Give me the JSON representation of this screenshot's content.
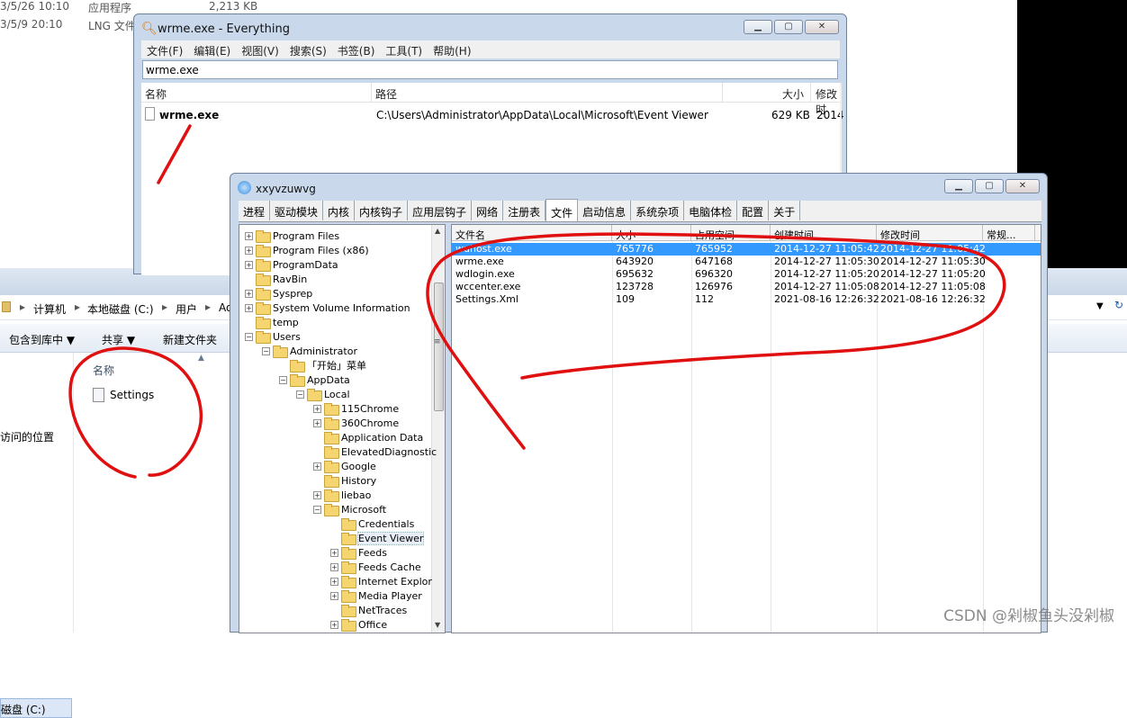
{
  "background_list": {
    "rows": [
      {
        "date": "3/5/26 10:10",
        "type": "应用程序",
        "size": "2,213 KB"
      },
      {
        "date": "3/5/9 20:10",
        "type": "LNG 文件",
        "size": ""
      }
    ]
  },
  "explorer": {
    "breadcrumb": [
      "计算机",
      "本地磁盘 (C:)",
      "用户",
      "Ad"
    ],
    "toolbar": {
      "include_library": "包含到库中 ▼",
      "share": "共享 ▼",
      "new_folder": "新建文件夹"
    },
    "column_name": "名称",
    "file_name": "Settings",
    "nav_recent": "访问的位置",
    "nav_drive": "磁盘 (C:)"
  },
  "everything": {
    "title": "wrme.exe - Everything",
    "menu": [
      "文件(F)",
      "编辑(E)",
      "视图(V)",
      "搜索(S)",
      "书签(B)",
      "工具(T)",
      "帮助(H)"
    ],
    "search_value": "wrme.exe",
    "columns": {
      "name": "名称",
      "path": "路径",
      "size": "大小",
      "modified": "修改时"
    },
    "result": {
      "name": "wrme.exe",
      "path": "C:\\Users\\Administrator\\AppData\\Local\\Microsoft\\Event Viewer",
      "size": "629 KB",
      "modified": "2014"
    }
  },
  "xw": {
    "title": "xxyvzuwvg",
    "tabs": [
      "进程",
      "驱动模块",
      "内核",
      "内核钩子",
      "应用层钩子",
      "网络",
      "注册表",
      "文件",
      "启动信息",
      "系统杂项",
      "电脑体检",
      "配置",
      "关于"
    ],
    "active_tab": "文件",
    "tree": [
      {
        "label": "Program Files",
        "level": 0,
        "pm": "+"
      },
      {
        "label": "Program Files (x86)",
        "level": 0,
        "pm": "+"
      },
      {
        "label": "ProgramData",
        "level": 0,
        "pm": "+"
      },
      {
        "label": "RavBin",
        "level": 0,
        "pm": ""
      },
      {
        "label": "Sysprep",
        "level": 0,
        "pm": "+"
      },
      {
        "label": "System Volume Information",
        "level": 0,
        "pm": "+"
      },
      {
        "label": "temp",
        "level": 0,
        "pm": ""
      },
      {
        "label": "Users",
        "level": 0,
        "pm": "-"
      },
      {
        "label": "Administrator",
        "level": 1,
        "pm": "-"
      },
      {
        "label": "「开始」菜单",
        "level": 2,
        "pm": ""
      },
      {
        "label": "AppData",
        "level": 2,
        "pm": "-"
      },
      {
        "label": "Local",
        "level": 3,
        "pm": "-"
      },
      {
        "label": "115Chrome",
        "level": 4,
        "pm": "+"
      },
      {
        "label": "360Chrome",
        "level": 4,
        "pm": "+"
      },
      {
        "label": "Application Data",
        "level": 4,
        "pm": ""
      },
      {
        "label": "ElevatedDiagnostic",
        "level": 4,
        "pm": ""
      },
      {
        "label": "Google",
        "level": 4,
        "pm": "+"
      },
      {
        "label": "History",
        "level": 4,
        "pm": ""
      },
      {
        "label": "liebao",
        "level": 4,
        "pm": "+"
      },
      {
        "label": "Microsoft",
        "level": 4,
        "pm": "-"
      },
      {
        "label": "Credentials",
        "level": 5,
        "pm": ""
      },
      {
        "label": "Event Viewer",
        "level": 5,
        "pm": "",
        "selected": true
      },
      {
        "label": "Feeds",
        "level": 5,
        "pm": "+"
      },
      {
        "label": "Feeds Cache",
        "level": 5,
        "pm": "+"
      },
      {
        "label": "Internet Explor",
        "level": 5,
        "pm": "+"
      },
      {
        "label": "Media Player",
        "level": 5,
        "pm": "+"
      },
      {
        "label": "NetTraces",
        "level": 5,
        "pm": ""
      },
      {
        "label": "Office",
        "level": 5,
        "pm": "+"
      }
    ],
    "grid_columns": [
      "文件名",
      "大小",
      "占用空间",
      "创建时间",
      "修改时间",
      "常规..."
    ],
    "grid_rows": [
      {
        "name": "wuhost.exe",
        "size": "765776",
        "alloc": "765952",
        "created": "2014-12-27 11:05:42",
        "modified": "2014-12-27 11:05:42",
        "selected": true
      },
      {
        "name": "wrme.exe",
        "size": "643920",
        "alloc": "647168",
        "created": "2014-12-27 11:05:30",
        "modified": "2014-12-27 11:05:30"
      },
      {
        "name": "wdlogin.exe",
        "size": "695632",
        "alloc": "696320",
        "created": "2014-12-27 11:05:20",
        "modified": "2014-12-27 11:05:20"
      },
      {
        "name": "wccenter.exe",
        "size": "123728",
        "alloc": "126976",
        "created": "2014-12-27 11:05:08",
        "modified": "2014-12-27 11:05:08"
      },
      {
        "name": "Settings.Xml",
        "size": "109",
        "alloc": "112",
        "created": "2021-08-16 12:26:32",
        "modified": "2021-08-16 12:26:32"
      }
    ]
  },
  "watermark": "CSDN @剁椒鱼头没剁椒",
  "colors": {
    "selection": "#3399ff",
    "annotation": "#e01010",
    "chrome": "#c9d8eb"
  }
}
